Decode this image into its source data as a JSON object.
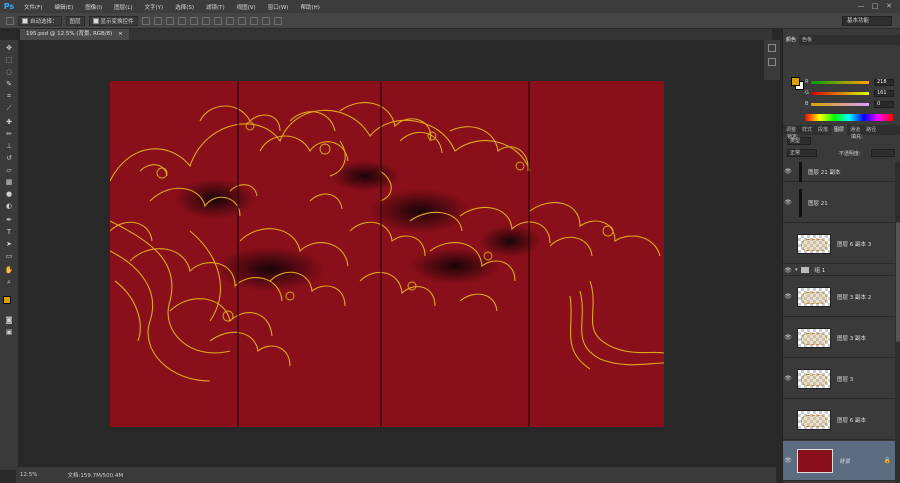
{
  "app": {
    "logo": "Ps"
  },
  "menu": [
    "文件(F)",
    "编辑(E)",
    "图像(I)",
    "图层(L)",
    "文字(Y)",
    "选择(S)",
    "滤镜(T)",
    "视图(V)",
    "窗口(W)",
    "帮助(H)"
  ],
  "window_controls": [
    "—",
    "□",
    "✕"
  ],
  "options": {
    "auto_select_label": "自动选择：",
    "auto_select_value": "图层",
    "transform_label": "显示变换控件",
    "workspace": "基本功能"
  },
  "document_tab": {
    "title": "195.psd @ 12.5% (背景, RGB/8)",
    "close": "×"
  },
  "status": {
    "zoom": "12.5%",
    "doc_info": "文档:159.7M/500.4M"
  },
  "color_panel": {
    "tabs": [
      "颜色",
      "色板"
    ],
    "channels": [
      {
        "label": "R",
        "value": "218"
      },
      {
        "label": "G",
        "value": "161"
      },
      {
        "label": "B",
        "value": "0"
      }
    ],
    "foreground": "#daa100",
    "background": "#ffffff"
  },
  "layers_panel": {
    "tabs": [
      "调整",
      "样式",
      "段落",
      "图层",
      "通道",
      "路径"
    ],
    "active_tab": "图层",
    "filter_kind": "类型",
    "blend_mode": "正常",
    "opacity_label": "不透明度:",
    "lock_label": "锁定:",
    "fill_label": "填充:",
    "layers": [
      {
        "name": "图层 21 副本",
        "kind": "text"
      },
      {
        "name": "图层 21",
        "kind": "text"
      },
      {
        "name": "图层 6 副本 3",
        "kind": "art"
      },
      {
        "name": "组 1",
        "kind": "group"
      },
      {
        "name": "图层 3 副本 2",
        "kind": "art"
      },
      {
        "name": "图层 3 副本",
        "kind": "art"
      },
      {
        "name": "图层 3",
        "kind": "art"
      },
      {
        "name": "图层 6 副本",
        "kind": "art"
      },
      {
        "name": "背景",
        "kind": "background"
      }
    ]
  },
  "colors": {
    "canvas_red": "#890f1a",
    "gold": "#e0a81c",
    "accent": "#31a8ff"
  }
}
